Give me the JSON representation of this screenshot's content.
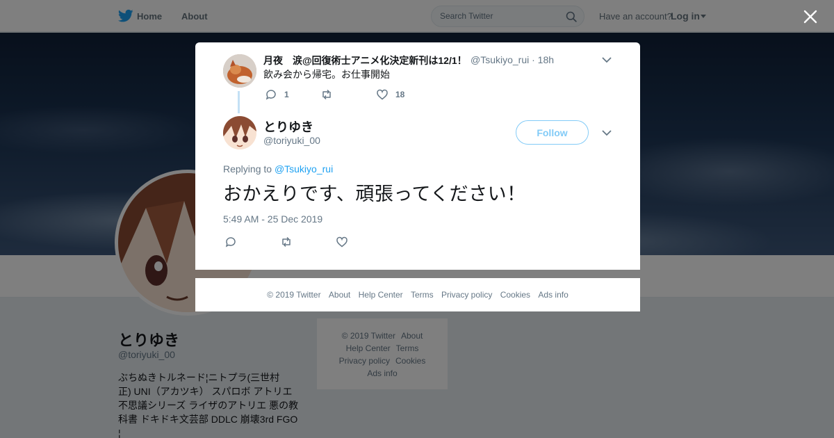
{
  "topbar": {
    "home_label": "Home",
    "about_label": "About",
    "search_placeholder": "Search Twitter",
    "account_prompt": "Have an account?",
    "login_label": "Log in"
  },
  "profile": {
    "name": "とりゆき",
    "handle": "@toriyuki_00",
    "bio_lines": [
      "ぶちぬきトルネード¦ニトプラ(三世村",
      "正) UNI（アカツキ） スパロボ アトリエ",
      "不思議シリーズ ライザのアトリエ 悪の教",
      "科書 ドキドキ文芸部 DDLC 崩壊3rd FGO",
      "¦"
    ]
  },
  "side_footer": {
    "items": [
      "© 2019 Twitter",
      "About",
      "Help Center",
      "Terms",
      "Privacy policy",
      "Cookies",
      "Ads info"
    ]
  },
  "parent_tweet": {
    "name": "月夜　涙@回復術士アニメ化決定新刊は12/1！",
    "handle_time": "@Tsukiyo_rui · 18h",
    "text": "飲み会から帰宅。お仕事開始",
    "reply_count": "1",
    "retweet_count": "",
    "like_count": "18"
  },
  "main_tweet": {
    "name": "とりゆき",
    "handle": "@toriyuki_00",
    "follow_label": "Follow",
    "replying_prefix": "Replying to",
    "replying_to": "@Tsukiyo_rui",
    "text": "おかえりです、頑張ってください！",
    "timestamp": "5:49 AM - 25 Dec 2019"
  },
  "modal_footer": {
    "items": [
      "© 2019 Twitter",
      "About",
      "Help Center",
      "Terms",
      "Privacy policy",
      "Cookies",
      "Ads info"
    ]
  },
  "colors": {
    "accent": "#1da1f2",
    "muted_text": "#657786",
    "overlay": "rgba(0,0,0,0.5)"
  }
}
